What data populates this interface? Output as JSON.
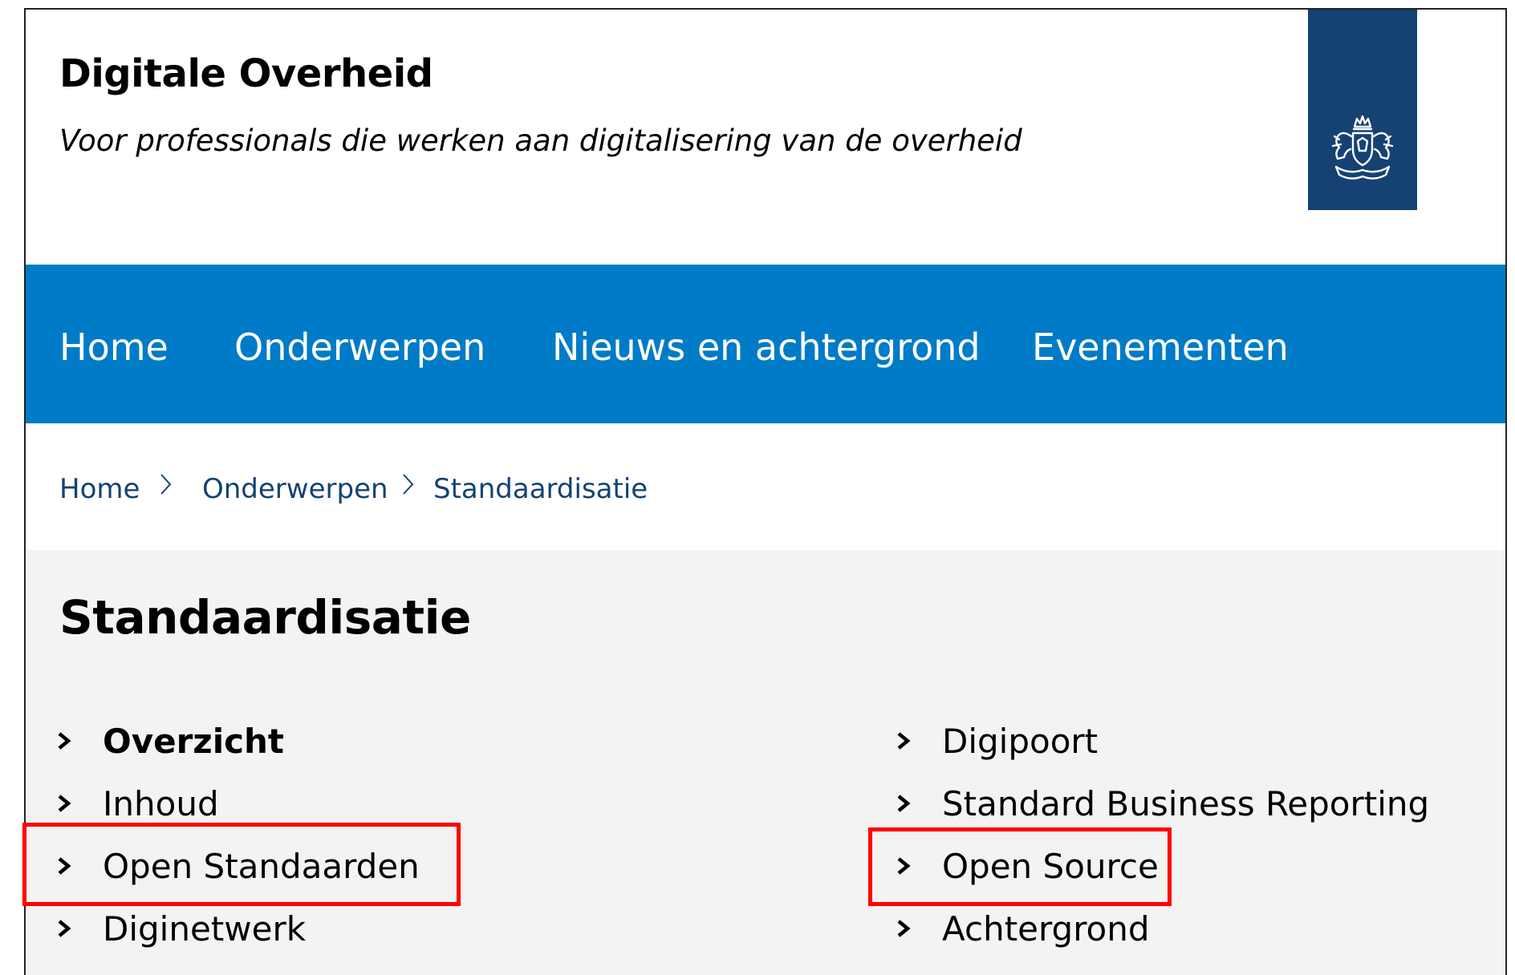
{
  "header": {
    "title": "Digitale Overheid",
    "tagline": "Voor professionals die werken aan digitalisering van de overheid",
    "logo_icon": "rijksoverheid-coat-of-arms-icon"
  },
  "nav": {
    "items": [
      "Home",
      "Onderwerpen",
      "Nieuws en achtergrond",
      "Evenementen"
    ]
  },
  "breadcrumb": {
    "items": [
      "Home",
      "Onderwerpen",
      "Standaardisatie"
    ],
    "separator_icon": "chevron-right-icon"
  },
  "content": {
    "title": "Standaardisatie",
    "left_links": [
      "Overzicht",
      "Inhoud",
      "Open Standaarden",
      "Diginetwerk"
    ],
    "right_links": [
      "Digipoort",
      "Standard Business Reporting",
      "Open Source",
      "Achtergrond"
    ],
    "active_link": "Overzicht",
    "highlighted_links": [
      "Open Standaarden",
      "Open Source"
    ]
  },
  "colors": {
    "nav_background": "#007bc7",
    "logo_background": "#154273",
    "content_background": "#f3f3f3",
    "highlight_border": "#ff0000"
  }
}
